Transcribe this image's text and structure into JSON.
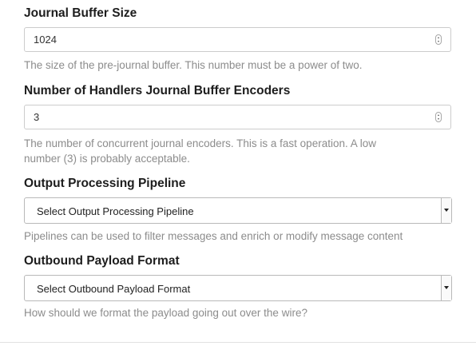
{
  "journal_buffer_size": {
    "label": "Journal Buffer Size",
    "value": "1024",
    "help": "The size of the pre-journal buffer. This number must be a power of two."
  },
  "journal_encoders": {
    "label": "Number of Handlers Journal Buffer Encoders",
    "value": "3",
    "help_line1": "The number of concurrent journal encoders. This is a fast operation. A low",
    "help_line2": "number (3) is probably acceptable."
  },
  "output_pipeline": {
    "label": "Output Processing Pipeline",
    "selected": "Select Output Processing Pipeline",
    "help": "Pipelines can be used to filter messages and enrich or modify message content"
  },
  "payload_format": {
    "label": "Outbound Payload Format",
    "selected": "Select Outbound Payload Format",
    "help": "How should we format the payload going out over the wire?"
  }
}
